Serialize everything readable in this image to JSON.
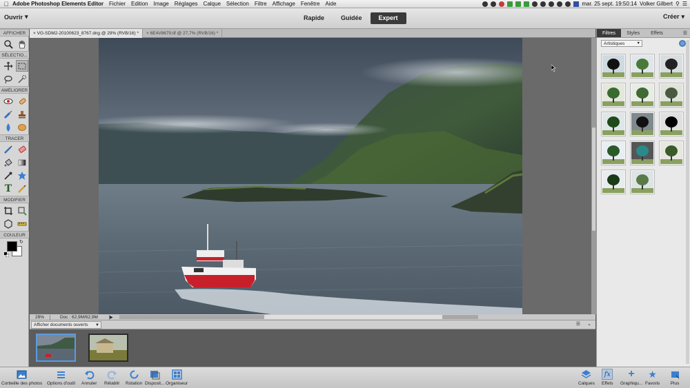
{
  "menubar": {
    "app_name": "Adobe Photoshop Elements Editor",
    "items": [
      "Fichier",
      "Edition",
      "Image",
      "Réglages",
      "Calque",
      "Sélection",
      "Filtre",
      "Affichage",
      "Fenêtre",
      "Aide"
    ],
    "datetime": "mar. 25 sept.  19:50:14",
    "user": "Volker Gilbert"
  },
  "appbar": {
    "open_label": "Ouvrir",
    "modes": [
      "Rapide",
      "Guidée",
      "Expert"
    ],
    "active_mode": "Expert",
    "create_label": "Créer"
  },
  "toolbar": {
    "sections": [
      "AFFICHER",
      "SÉLECTIO...",
      "AMÉLIORER",
      "TRACER",
      "MODIFIER",
      "COULEUR"
    ]
  },
  "document_tabs": [
    {
      "label": "VG-SDM2-20100623_8767.dng @ 29% (RVB/16) *",
      "active": true
    },
    {
      "label": "6E4V8679.tif @ 27,7% (RVB/16) *",
      "active": false
    }
  ],
  "statusbar": {
    "zoom": "29%",
    "doc_size": "Doc : 62,9M/62,9M"
  },
  "photo_bin": {
    "dropdown": "Afficher documents ouverts"
  },
  "panel": {
    "tabs": [
      "Filtres",
      "Styles",
      "Effets"
    ],
    "active_tab": "Filtres",
    "category": "Artistiques",
    "filter_count": 14
  },
  "taskbar": {
    "left": [
      "Corbeille des photos",
      "Options d'outil",
      "Annuler",
      "Rétablir",
      "Rotation",
      "Disposit...",
      "Organiseur"
    ],
    "right": [
      "Calques",
      "Effets",
      "Graphiqu...",
      "Favoris",
      "Plus"
    ]
  },
  "colors": {
    "accent": "#5a9be0",
    "boat_red": "#c8202a"
  }
}
